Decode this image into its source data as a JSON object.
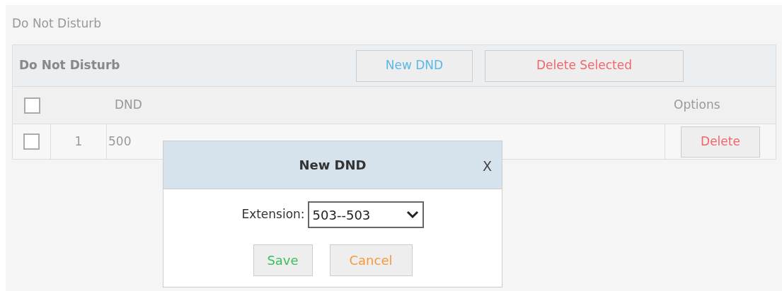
{
  "page_title": "Do Not Disturb",
  "table": {
    "title": "Do Not Disturb",
    "buttons": [
      {
        "label": "New DND",
        "kind": "new"
      },
      {
        "label": "Delete Selected",
        "kind": "delete"
      }
    ],
    "select_all": {
      "checked": false
    },
    "columns": [
      "DND",
      "Options"
    ],
    "rows": [
      {
        "checked": false,
        "index": "1",
        "dnd": "500",
        "action": "Delete"
      }
    ]
  },
  "dialog": {
    "title": "New DND",
    "close": "X",
    "field_label": "Extension:",
    "field_value": "503--503",
    "buttons": [
      {
        "label": "Save",
        "kind": "save"
      },
      {
        "label": "Cancel",
        "kind": "cancel"
      }
    ]
  }
}
